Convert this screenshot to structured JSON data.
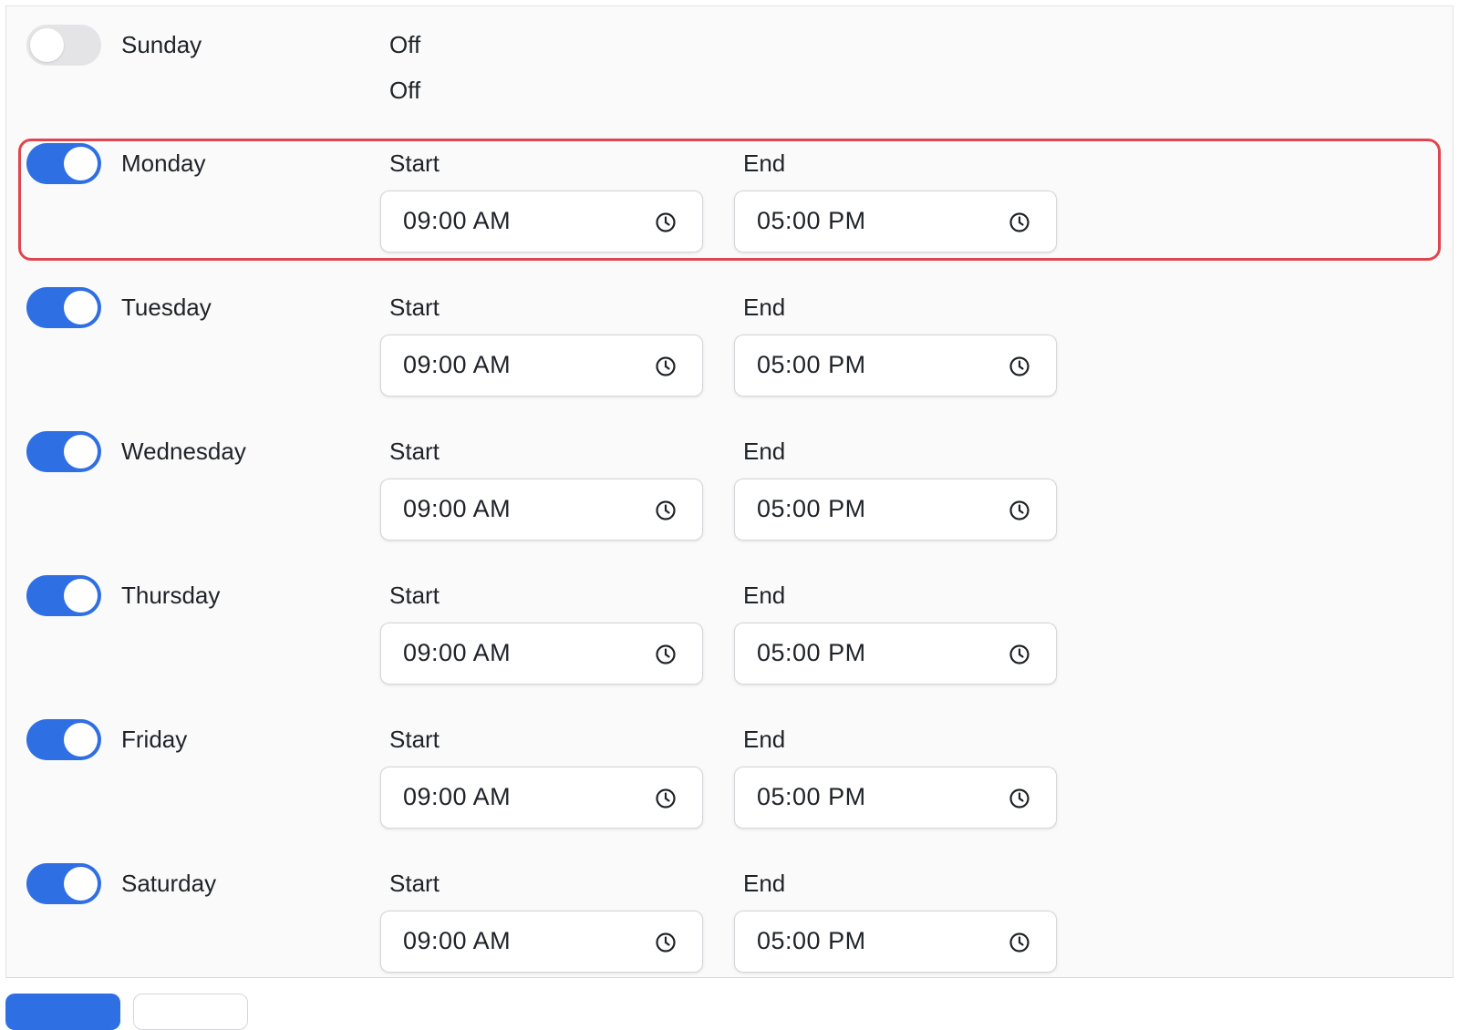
{
  "labels": {
    "start": "Start",
    "end": "End",
    "off": "Off"
  },
  "days": [
    {
      "name": "Sunday",
      "enabled": false,
      "status_line1": "Off",
      "status_line2": "Off"
    },
    {
      "name": "Monday",
      "enabled": true,
      "start": "09:00 AM",
      "end": "05:00 PM"
    },
    {
      "name": "Tuesday",
      "enabled": true,
      "start": "09:00 AM",
      "end": "05:00 PM"
    },
    {
      "name": "Wednesday",
      "enabled": true,
      "start": "09:00 AM",
      "end": "05:00 PM"
    },
    {
      "name": "Thursday",
      "enabled": true,
      "start": "09:00 AM",
      "end": "05:00 PM"
    },
    {
      "name": "Friday",
      "enabled": true,
      "start": "09:00 AM",
      "end": "05:00 PM"
    },
    {
      "name": "Saturday",
      "enabled": true,
      "start": "09:00 AM",
      "end": "05:00 PM"
    }
  ],
  "icons": {
    "time_input_icon": "clock-icon"
  },
  "colors": {
    "toggle_on": "#2f6fe4",
    "toggle_off": "#e4e4e7",
    "highlight_border": "#e0464f"
  }
}
